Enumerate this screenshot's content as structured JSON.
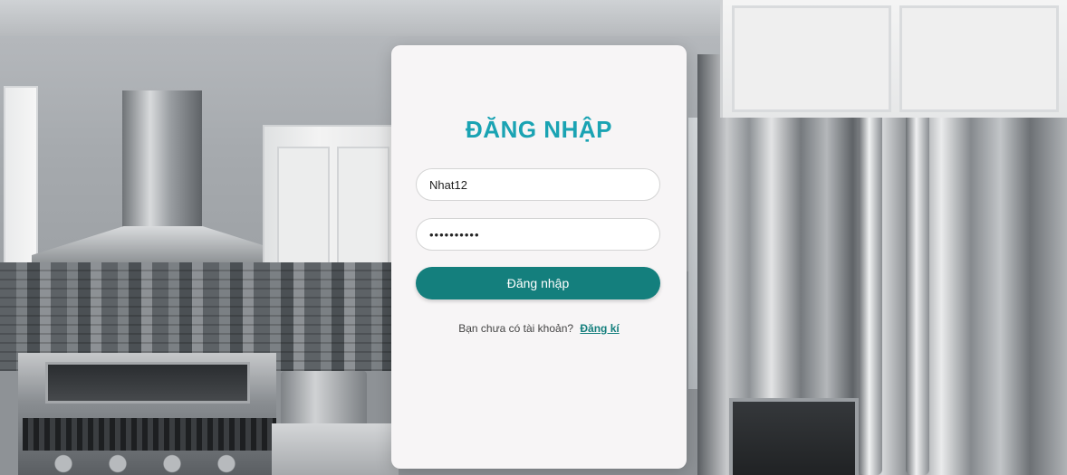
{
  "login": {
    "title": "ĐĂNG NHẬP",
    "username_value": "Nhat12",
    "password_value": "••••••••••",
    "submit_label": "Đăng nhập",
    "signup_prompt": "Bạn chưa có tài khoản?",
    "signup_link": "Đăng kí"
  },
  "colors": {
    "accent": "#1aa3b3",
    "button": "#147f7d",
    "card_background": "#f7f5f6"
  }
}
